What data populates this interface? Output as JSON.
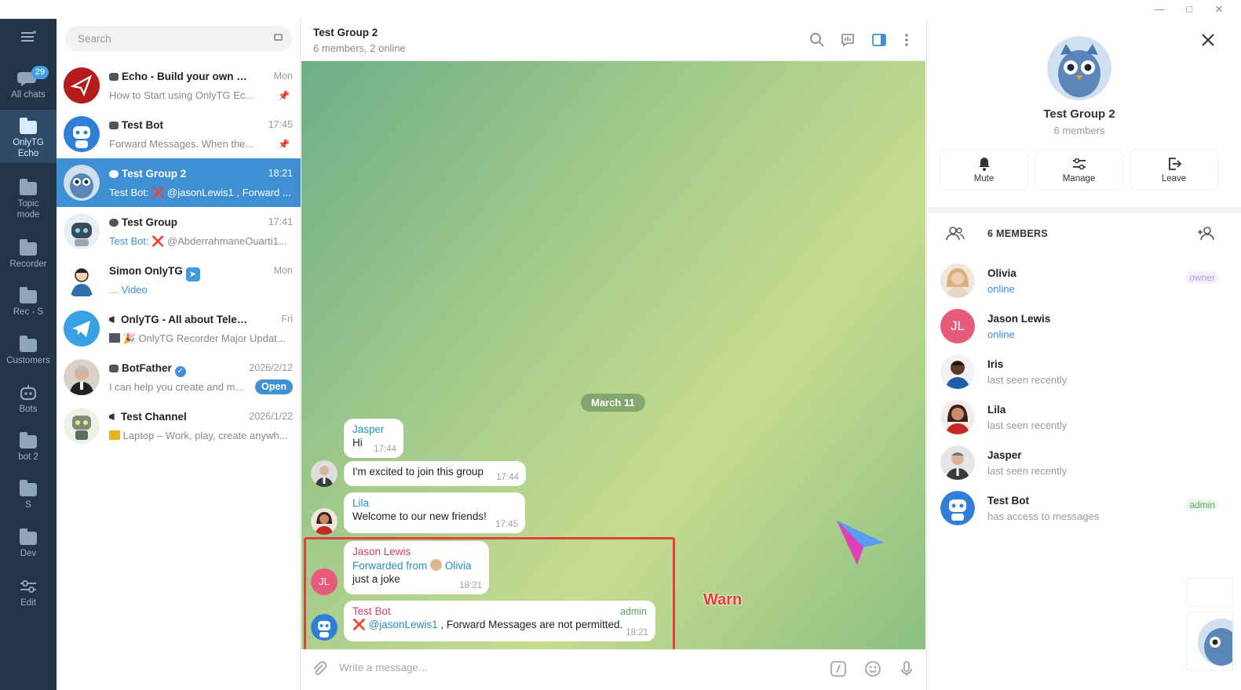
{
  "rail": {
    "all_chats": "All chats",
    "all_chats_badge": "29",
    "folders": [
      "OnlyTG Echo",
      "Topic mode",
      "Recorder",
      "Rec - S",
      "Customers",
      "Bots",
      "bot 2",
      "S",
      "Dev",
      "Edit"
    ]
  },
  "search": {
    "placeholder": "Search"
  },
  "chats": [
    {
      "name": "Echo - Build your own smar...",
      "time": "Mon",
      "preview": "How to Start using OnlyTG Ec..."
    },
    {
      "name": "Test Bot",
      "time": "17:45",
      "preview": "Forward Messages. When the..."
    },
    {
      "name": "Test Group 2",
      "time": "18:21",
      "preview_sender": "Test Bot:",
      "preview": "@jasonLewis1 , Forward ..."
    },
    {
      "name": "Test Group",
      "time": "17:41",
      "preview_sender": "Test Bot:",
      "preview": "@AbderrahmaneOuarti1..."
    },
    {
      "name": "Simon OnlyTG",
      "time": "Mon",
      "preview": "Video"
    },
    {
      "name": "OnlyTG - All about Telegram",
      "time": "Fri",
      "preview": "OnlyTG Recorder Major Updat..."
    },
    {
      "name": "BotFather",
      "time": "2026/2/12",
      "preview": "I can help you create and ma...",
      "action": "Open"
    },
    {
      "name": "Test Channel",
      "time": "2026/1/22",
      "preview": "Laptop – Work, play, create anywh..."
    }
  ],
  "header": {
    "title": "Test Group 2",
    "subtitle": "6 members, 2 online"
  },
  "conversation": {
    "date": "March 11",
    "messages": [
      {
        "sender": "Jasper",
        "text": "Hi",
        "time": "17:44"
      },
      {
        "text": "I'm excited to join this group",
        "time": "17:44"
      },
      {
        "sender": "Lila",
        "text": "Welcome to our new friends!",
        "time": "17:45"
      },
      {
        "sender": "Jason Lewis",
        "forwarded_label": "Forwarded from",
        "forwarded_name": "Olivia",
        "text": "just a joke",
        "time": "18:21",
        "avatar_initials": "JL"
      },
      {
        "sender": "Test Bot",
        "tag": "admin",
        "mention": "@jasonLewis1",
        "text": ", Forward Messages are not permitted.",
        "time": "18:21"
      }
    ],
    "annotation": "Warn"
  },
  "composer": {
    "placeholder": "Write a message..."
  },
  "panel": {
    "title": "Test Group 2",
    "subtitle": "6 members",
    "buttons": {
      "mute": "Mute",
      "manage": "Manage",
      "leave": "Leave"
    },
    "members_heading": "6 MEMBERS",
    "members": [
      {
        "name": "Olivia",
        "status": "online",
        "role": "owner"
      },
      {
        "name": "Jason Lewis",
        "status": "online",
        "initials": "JL"
      },
      {
        "name": "Iris",
        "status": "last seen recently"
      },
      {
        "name": "Lila",
        "status": "last seen recently"
      },
      {
        "name": "Jasper",
        "status": "last seen recently"
      },
      {
        "name": "Test Bot",
        "status": "has access to messages",
        "role": "admin"
      }
    ]
  },
  "colors": {
    "accent": "#3f8fd4",
    "rail_bg": "#243447",
    "warn": "#e0403f",
    "jl_avatar": "#e85a7c"
  }
}
